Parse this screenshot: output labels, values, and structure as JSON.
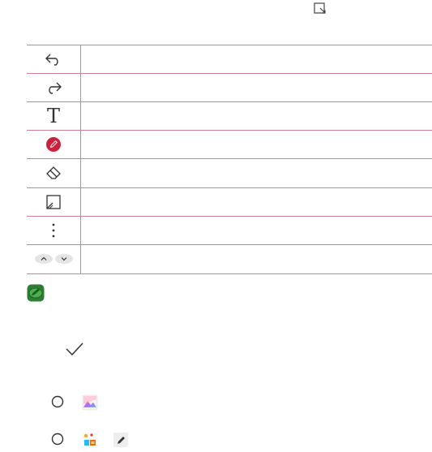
{
  "page": {
    "top_icon": "screen-capture-icon",
    "note_icon": "note-pencil-icon",
    "check_icon": "checkmark-icon"
  },
  "tools": [
    {
      "icon": "undo-icon",
      "description": ""
    },
    {
      "icon": "redo-icon",
      "description": ""
    },
    {
      "icon": "text-icon",
      "description": "",
      "glyph": "T"
    },
    {
      "icon": "pen-icon",
      "description": "",
      "color": "#c8223f"
    },
    {
      "icon": "eraser-icon",
      "description": ""
    },
    {
      "icon": "crop-icon",
      "description": ""
    },
    {
      "icon": "more-options-icon",
      "description": ""
    },
    {
      "icon": "scroll-up-down-icon",
      "description": ""
    }
  ],
  "options": [
    {
      "radio": "radio-icon",
      "icons": [
        "gallery-icon"
      ]
    },
    {
      "radio": "radio-icon",
      "icons": [
        "apps-folder-icon",
        "pen-tile-icon"
      ]
    }
  ],
  "colors": {
    "table_line": "#cf7f95",
    "pen_red": "#c8223f",
    "note_green": "#3aa64a"
  }
}
